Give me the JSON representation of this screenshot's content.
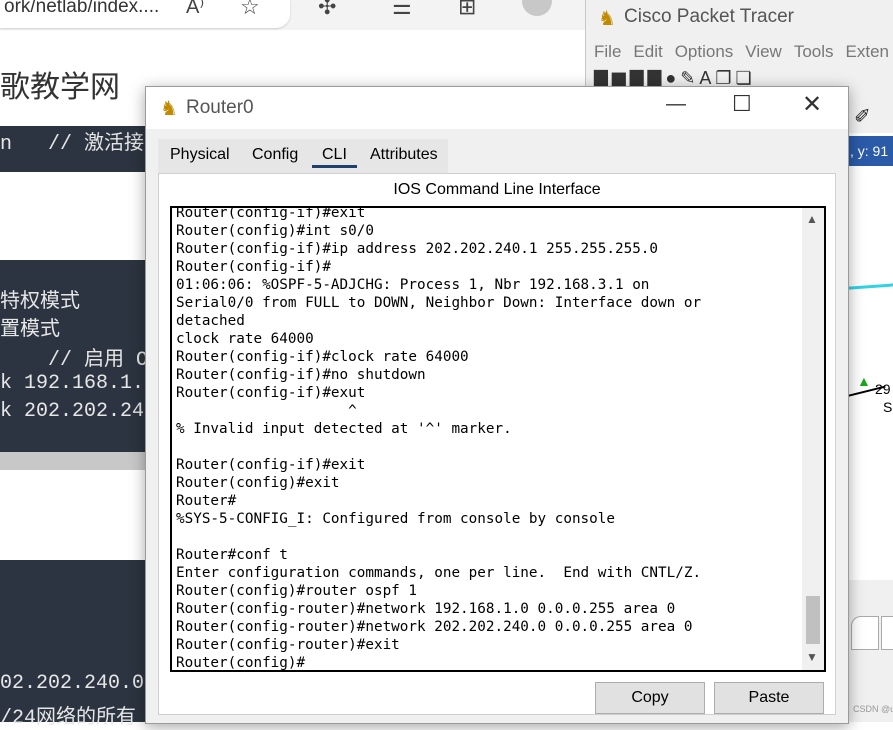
{
  "browser": {
    "url": "ork/netlab/index....",
    "read_aloud_icon": "A⁾",
    "site_title": "歌教学网",
    "code_top": "n   // 激活接",
    "code_lines": [
      "特权模式",
      "置模式",
      "    // 启用 OS",
      "k 192.168.1.",
      "k 202.202.24"
    ],
    "code_bottom": [
      "02.202.240.0",
      "/24网络的所有"
    ]
  },
  "cpt": {
    "title": "Cisco Packet Tracer",
    "menu": [
      "File",
      "Edit",
      "Options",
      "View",
      "Tools",
      "Exten"
    ],
    "coord": ", y: 91",
    "device_label": "29",
    "device_sub": "S",
    "watermark": "CSDN @une*"
  },
  "router": {
    "title": "Router0",
    "tabs": [
      "Physical",
      "Config",
      "CLI",
      "Attributes"
    ],
    "active_tab": "CLI",
    "heading": "IOS Command Line Interface",
    "cli_lines": [
      "Router(config-if)#exit",
      "Router(config)#int s0/0",
      "Router(config-if)#ip address 202.202.240.1 255.255.255.0",
      "Router(config-if)#",
      "01:06:06: %OSPF-5-ADJCHG: Process 1, Nbr 192.168.3.1 on",
      "Serial0/0 from FULL to DOWN, Neighbor Down: Interface down or",
      "detached",
      "clock rate 64000",
      "Router(config-if)#clock rate 64000",
      "Router(config-if)#no shutdown",
      "Router(config-if)#exut",
      "                    ^",
      "% Invalid input detected at '^' marker.",
      "",
      "Router(config-if)#exit",
      "Router(config)#exit",
      "Router#",
      "%SYS-5-CONFIG_I: Configured from console by console",
      "",
      "Router#conf t",
      "Enter configuration commands, one per line.  End with CNTL/Z.",
      "Router(config)#router ospf 1",
      "Router(config-router)#network 192.168.1.0 0.0.0.255 area 0",
      "Router(config-router)#network 202.202.240.0 0.0.0.255 area 0",
      "Router(config-router)#exit",
      "Router(config)#"
    ],
    "copy_label": "Copy",
    "paste_label": "Paste"
  }
}
